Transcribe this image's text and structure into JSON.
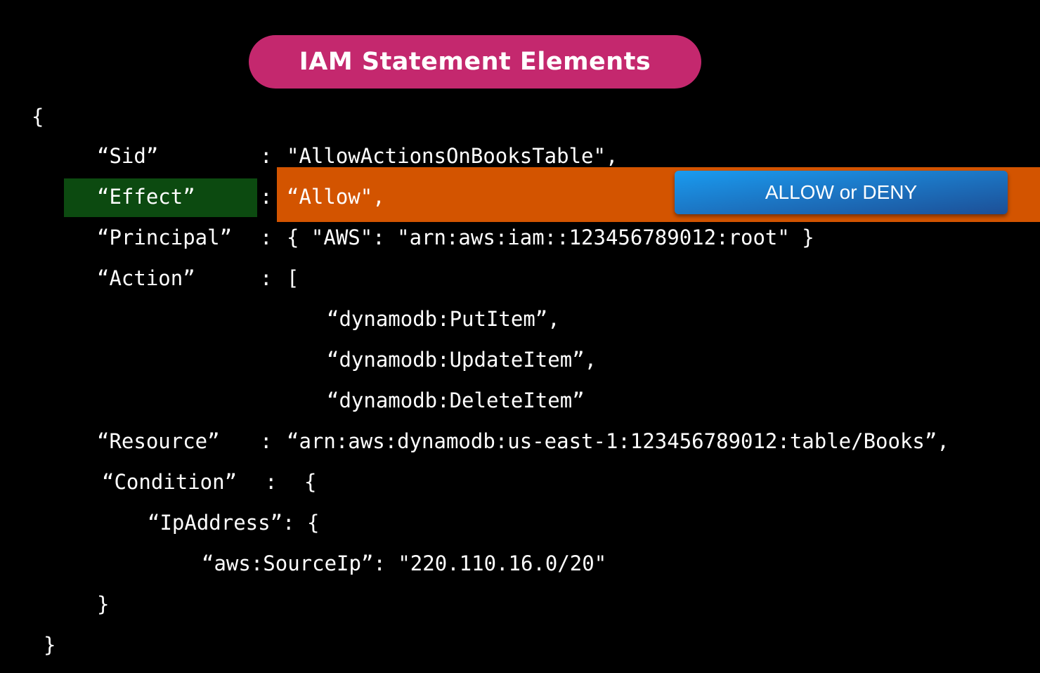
{
  "title": "IAM Statement Elements",
  "callout": "ALLOW or DENY",
  "colors": {
    "background": "#000000",
    "title_pill": "#c4286e",
    "effect_key_highlight": "#0c4a10",
    "effect_value_highlight": "#d35400",
    "callout_top": "#1a9bf0",
    "callout_bottom": "#1d4f96",
    "text": "#ffffff"
  },
  "code": {
    "open_brace": "{",
    "sid_key": "“Sid”",
    "sid_colon": ":",
    "sid_value": "\"AllowActionsOnBooksTable\",",
    "effect_key": "“Effect”",
    "effect_colon": ":",
    "effect_value": "“Allow\",",
    "principal_key": "“Principal”",
    "principal_colon": ":",
    "principal_value": "{ \"AWS\": \"arn:aws:iam::123456789012:root\" }",
    "action_key": "“Action”",
    "action_colon": ":",
    "action_open": "[",
    "action_1": "“dynamodb:PutItem”,",
    "action_2": "“dynamodb:UpdateItem”,",
    "action_3": "“dynamodb:DeleteItem”",
    "resource_key": "“Resource”",
    "resource_colon": ":",
    "resource_value": "“arn:aws:dynamodb:us-east-1:123456789012:table/Books”,",
    "condition_key": "“Condition”",
    "condition_colon": ":",
    "condition_open": "{",
    "ipaddress_line": "“IpAddress”: {",
    "sourceip_line": "“aws:SourceIp”: \"220.110.16.0/20\"",
    "inner_close": "}",
    "close_brace": "}"
  }
}
